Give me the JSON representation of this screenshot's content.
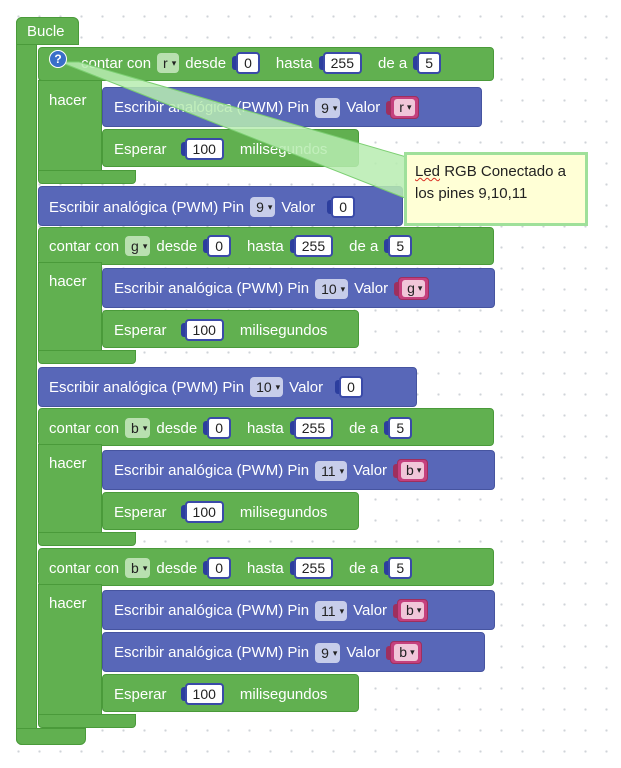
{
  "loop": {
    "label": "Bucle"
  },
  "hacer_label": "hacer",
  "comment": {
    "squiggle_word": "Led",
    "rest": " RGB Conectado a los pines 9,10,11"
  },
  "loops": [
    {
      "label": "contar con",
      "var": "r",
      "desde": "desde",
      "from": "0",
      "hasta": "hasta",
      "to": "255",
      "de_a": "de a",
      "step": "5"
    },
    {
      "label": "contar con",
      "var": "g",
      "desde": "desde",
      "from": "0",
      "hasta": "hasta",
      "to": "255",
      "de_a": "de a",
      "step": "5"
    },
    {
      "label": "contar con",
      "var": "b",
      "desde": "desde",
      "from": "0",
      "hasta": "hasta",
      "to": "255",
      "de_a": "de a",
      "step": "5"
    },
    {
      "label": "contar con",
      "var": "b",
      "desde": "desde",
      "from": "0",
      "hasta": "hasta",
      "to": "255",
      "de_a": "de a",
      "step": "5"
    }
  ],
  "inner": [
    {
      "write": "Escribir analógica (PWM) Pin",
      "pin": "9",
      "valor": "Valor",
      "value_var": "r",
      "wait": "Esperar",
      "ms": "100",
      "ms_label": "milisegundos"
    },
    {
      "write": "Escribir analógica (PWM) Pin",
      "pin": "10",
      "valor": "Valor",
      "value_var": "g",
      "wait": "Esperar",
      "ms": "100",
      "ms_label": "milisegundos"
    },
    {
      "write": "Escribir analógica (PWM) Pin",
      "pin": "11",
      "valor": "Valor",
      "value_var": "b",
      "wait": "Esperar",
      "ms": "100",
      "ms_label": "milisegundos"
    },
    {
      "write": "Escribir analógica (PWM) Pin",
      "pin": "11",
      "valor": "Valor",
      "value_var": "b",
      "write2": "Escribir analógica (PWM) Pin",
      "pin2": "9",
      "valor2": "Valor",
      "value_var2": "b",
      "wait": "Esperar",
      "ms": "100",
      "ms_label": "milisegundos"
    }
  ],
  "resets": [
    {
      "write": "Escribir analógica (PWM) Pin",
      "pin": "9",
      "valor": "Valor",
      "value": "0"
    },
    {
      "write": "Escribir analógica (PWM) Pin",
      "pin": "10",
      "valor": "Valor",
      "value": "0"
    }
  ],
  "dropdown_arrow": "▾",
  "help_icon": "?",
  "colors": {
    "loop_green": "#61b050",
    "io_blue": "#5867b8",
    "var_pink": "#c4417e",
    "comment_yellow": "#ffffd6",
    "comment_border": "#9fe09a"
  }
}
